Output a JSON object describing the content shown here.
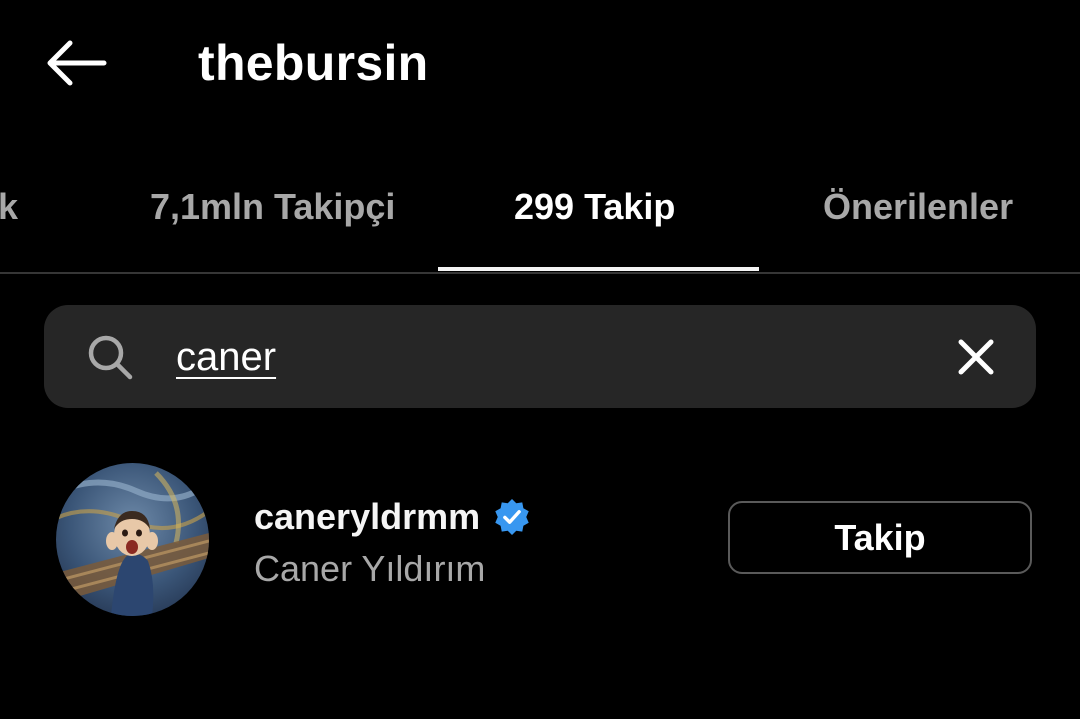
{
  "header": {
    "title": "thebursin",
    "back_icon": "arrow-left-icon"
  },
  "tabs": [
    {
      "label": "k",
      "active": false
    },
    {
      "label": "7,1mln Takipçi",
      "active": false
    },
    {
      "label": "299 Takip",
      "active": true
    },
    {
      "label": "Önerilenler",
      "active": false
    }
  ],
  "search": {
    "icon": "search-icon",
    "value": "caner",
    "clear_icon": "close-icon"
  },
  "results": [
    {
      "username": "caneryldrmm",
      "verified": true,
      "full_name": "Caner Yıldırım",
      "button_label": "Takip"
    }
  ],
  "colors": {
    "background": "#000000",
    "search_bg": "#262626",
    "secondary_text": "#a8a8a8",
    "verified_badge": "#3897f0",
    "button_border": "#5a5a5a"
  }
}
